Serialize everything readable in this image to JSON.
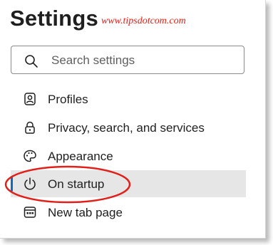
{
  "header": {
    "title": "Settings",
    "watermark": "www.tipsdotcom.com"
  },
  "search": {
    "placeholder": "Search settings",
    "value": "",
    "icon": "search-icon"
  },
  "nav": {
    "items": [
      {
        "label": "Profiles",
        "icon": "profile-icon",
        "active": false
      },
      {
        "label": "Privacy, search, and services",
        "icon": "lock-icon",
        "active": false
      },
      {
        "label": "Appearance",
        "icon": "palette-icon",
        "active": false
      },
      {
        "label": "On startup",
        "icon": "power-icon",
        "active": true
      },
      {
        "label": "New tab page",
        "icon": "new-tab-icon",
        "active": false
      }
    ]
  },
  "colors": {
    "accent": "#0f6cbd",
    "highlight_ellipse": "#e0201b",
    "watermark": "#e0201b",
    "active_background": "#e6e6e6"
  }
}
